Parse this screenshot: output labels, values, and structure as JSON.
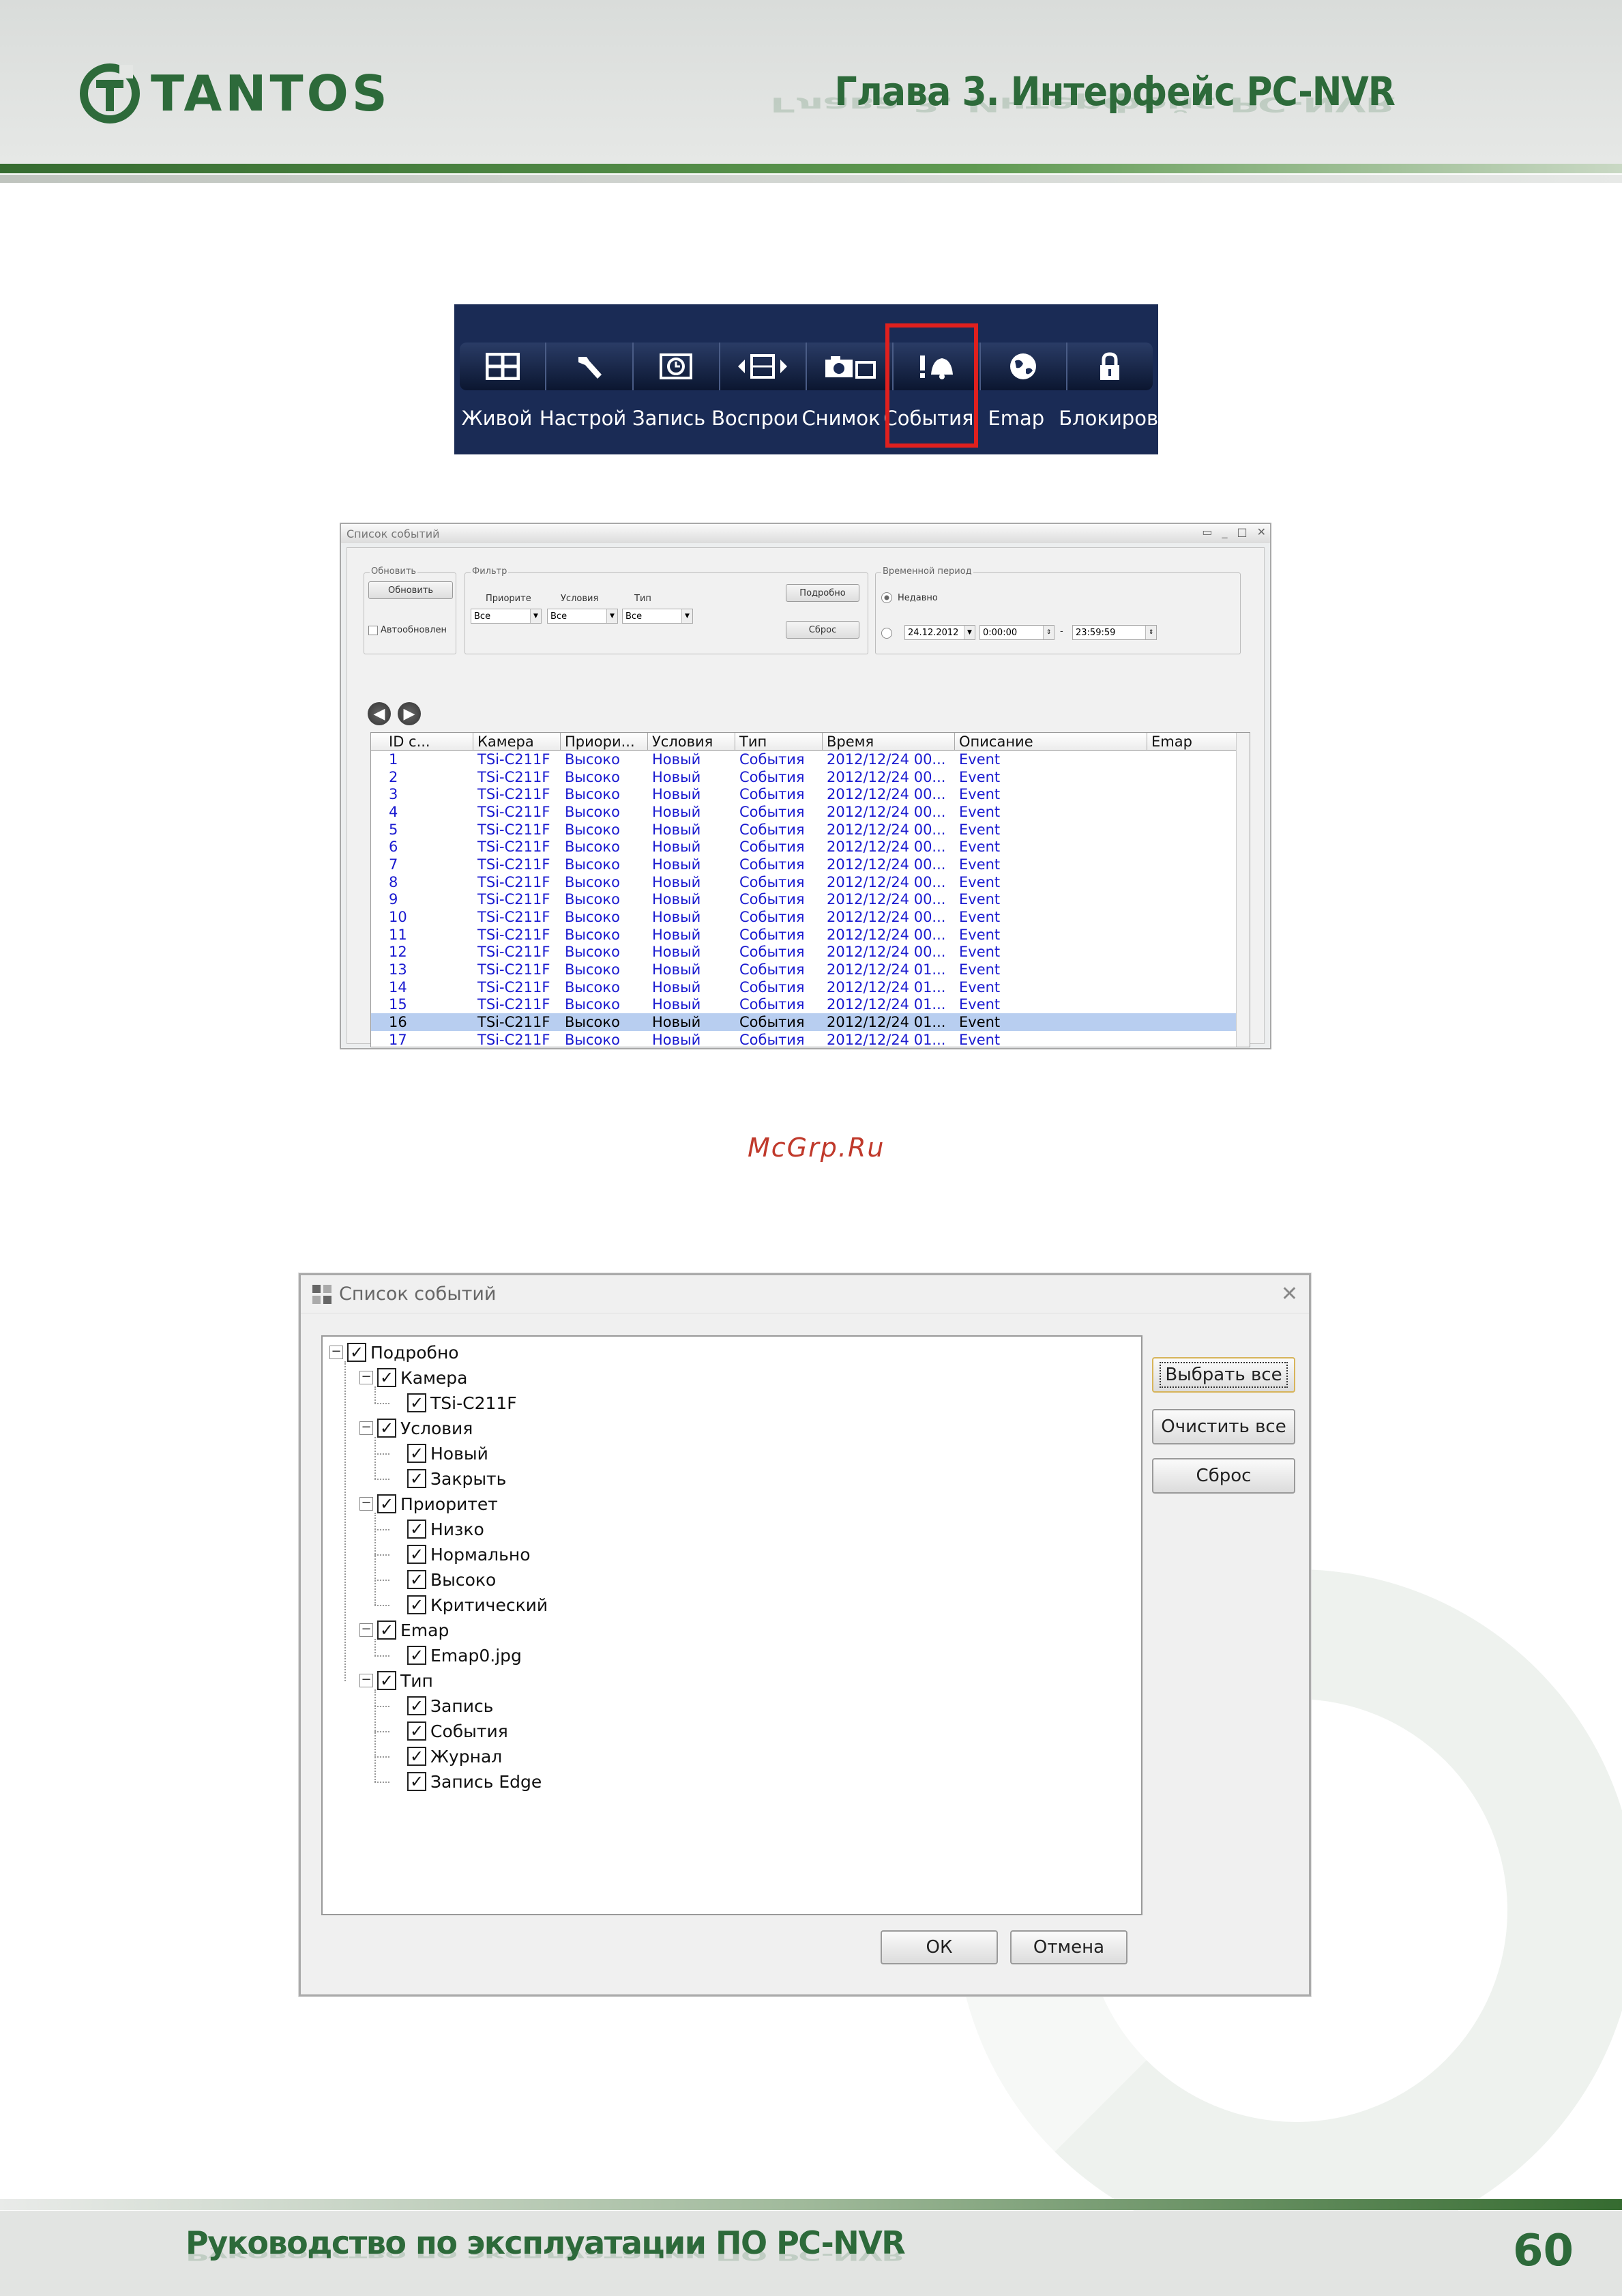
{
  "header": {
    "logo_text": "TANTOS",
    "chapter_title": "Глава 3. Интерфейс PC-NVR"
  },
  "toolbar": {
    "items": [
      {
        "icon": "grid-icon",
        "label": "Живой"
      },
      {
        "icon": "wrench-icon",
        "label": "Настрой"
      },
      {
        "icon": "clock-icon",
        "label": "Запись"
      },
      {
        "icon": "film-icon",
        "label": "Воспрои"
      },
      {
        "icon": "camera-icon",
        "label": "Снимок"
      },
      {
        "icon": "bell-alert-icon",
        "label": "События"
      },
      {
        "icon": "globe-icon",
        "label": "Emap"
      },
      {
        "icon": "lock-icon",
        "label": "Блокиров"
      }
    ],
    "highlighted": "События",
    "highlight_color": "#e0201e"
  },
  "event_window": {
    "title": "Список событий",
    "refresh_group": "Обновить",
    "refresh_button": "Обновить",
    "auto_refresh": "Автообновлен",
    "filter_group": "Фильтр",
    "priority_label": "Приорите",
    "condition_label": "Условия",
    "type_label": "Тип",
    "priority_value": "Все",
    "condition_value": "Все",
    "type_value": "Все",
    "details_button": "Подробно",
    "reset_button": "Сброс",
    "period_group": "Временной период",
    "recent_label": "Недавно",
    "date_value": "24.12.2012",
    "time_from": "0:00:00",
    "dash": "-",
    "time_to": "23:59:59",
    "columns": [
      "ID с...",
      "Камера",
      "Приори...",
      "Условия",
      "Тип",
      "Время",
      "Описание",
      "Emap"
    ],
    "rows": [
      [
        "1",
        "TSi-C211F",
        "Высоко",
        "Новый",
        "События",
        "2012/12/24 00...",
        "Event",
        ""
      ],
      [
        "2",
        "TSi-C211F",
        "Высоко",
        "Новый",
        "События",
        "2012/12/24 00...",
        "Event",
        ""
      ],
      [
        "3",
        "TSi-C211F",
        "Высоко",
        "Новый",
        "События",
        "2012/12/24 00...",
        "Event",
        ""
      ],
      [
        "4",
        "TSi-C211F",
        "Высоко",
        "Новый",
        "События",
        "2012/12/24 00...",
        "Event",
        ""
      ],
      [
        "5",
        "TSi-C211F",
        "Высоко",
        "Новый",
        "События",
        "2012/12/24 00...",
        "Event",
        ""
      ],
      [
        "6",
        "TSi-C211F",
        "Высоко",
        "Новый",
        "События",
        "2012/12/24 00...",
        "Event",
        ""
      ],
      [
        "7",
        "TSi-C211F",
        "Высоко",
        "Новый",
        "События",
        "2012/12/24 00...",
        "Event",
        ""
      ],
      [
        "8",
        "TSi-C211F",
        "Высоко",
        "Новый",
        "События",
        "2012/12/24 00...",
        "Event",
        ""
      ],
      [
        "9",
        "TSi-C211F",
        "Высоко",
        "Новый",
        "События",
        "2012/12/24 00...",
        "Event",
        ""
      ],
      [
        "10",
        "TSi-C211F",
        "Высоко",
        "Новый",
        "События",
        "2012/12/24 00...",
        "Event",
        ""
      ],
      [
        "11",
        "TSi-C211F",
        "Высоко",
        "Новый",
        "События",
        "2012/12/24 00...",
        "Event",
        ""
      ],
      [
        "12",
        "TSi-C211F",
        "Высоко",
        "Новый",
        "События",
        "2012/12/24 00...",
        "Event",
        ""
      ],
      [
        "13",
        "TSi-C211F",
        "Высоко",
        "Новый",
        "События",
        "2012/12/24 01...",
        "Event",
        ""
      ],
      [
        "14",
        "TSi-C211F",
        "Высоко",
        "Новый",
        "События",
        "2012/12/24 01...",
        "Event",
        ""
      ],
      [
        "15",
        "TSi-C211F",
        "Высоко",
        "Новый",
        "События",
        "2012/12/24 01...",
        "Event",
        ""
      ],
      [
        "16",
        "TSi-C211F",
        "Высоко",
        "Новый",
        "События",
        "2012/12/24 01...",
        "Event",
        ""
      ],
      [
        "17",
        "TSi-C211F",
        "Высоко",
        "Новый",
        "События",
        "2012/12/24 01...",
        "Event",
        ""
      ]
    ],
    "selected_row": "16"
  },
  "watermark": "McGrp.Ru",
  "filter_dialog": {
    "title": "Список событий",
    "tree": [
      {
        "label": "Подробно",
        "level": 0,
        "checked": true
      },
      {
        "label": "Камера",
        "level": 1,
        "checked": true
      },
      {
        "label": "TSi-C211F",
        "level": 2,
        "checked": true
      },
      {
        "label": "Условия",
        "level": 1,
        "checked": true
      },
      {
        "label": "Новый",
        "level": 2,
        "checked": true
      },
      {
        "label": "Закрыть",
        "level": 2,
        "checked": true
      },
      {
        "label": "Приоритет",
        "level": 1,
        "checked": true
      },
      {
        "label": "Низко",
        "level": 2,
        "checked": true
      },
      {
        "label": "Нормально",
        "level": 2,
        "checked": true
      },
      {
        "label": "Высоко",
        "level": 2,
        "checked": true
      },
      {
        "label": "Критический",
        "level": 2,
        "checked": true
      },
      {
        "label": "Emap",
        "level": 1,
        "checked": true
      },
      {
        "label": "Emap0.jpg",
        "level": 2,
        "checked": true
      },
      {
        "label": "Тип",
        "level": 1,
        "checked": true
      },
      {
        "label": "Запись",
        "level": 2,
        "checked": true
      },
      {
        "label": "События",
        "level": 2,
        "checked": true
      },
      {
        "label": "Журнал",
        "level": 2,
        "checked": true
      },
      {
        "label": "Запись Edge",
        "level": 2,
        "checked": true
      }
    ],
    "select_all": "Выбрать все",
    "clear_all": "Очистить все",
    "reset": "Сброс",
    "ok": "ОК",
    "cancel": "Отмена"
  },
  "footer": {
    "title": "Руководство по эксплуатации ПО PC-NVR",
    "page_number": "60"
  },
  "colors": {
    "brand_green": "#2d6a3a",
    "toolbar_bg": "#1a2b55",
    "row_text": "#1a1ad0",
    "selected_row_bg": "#b8cef0"
  }
}
